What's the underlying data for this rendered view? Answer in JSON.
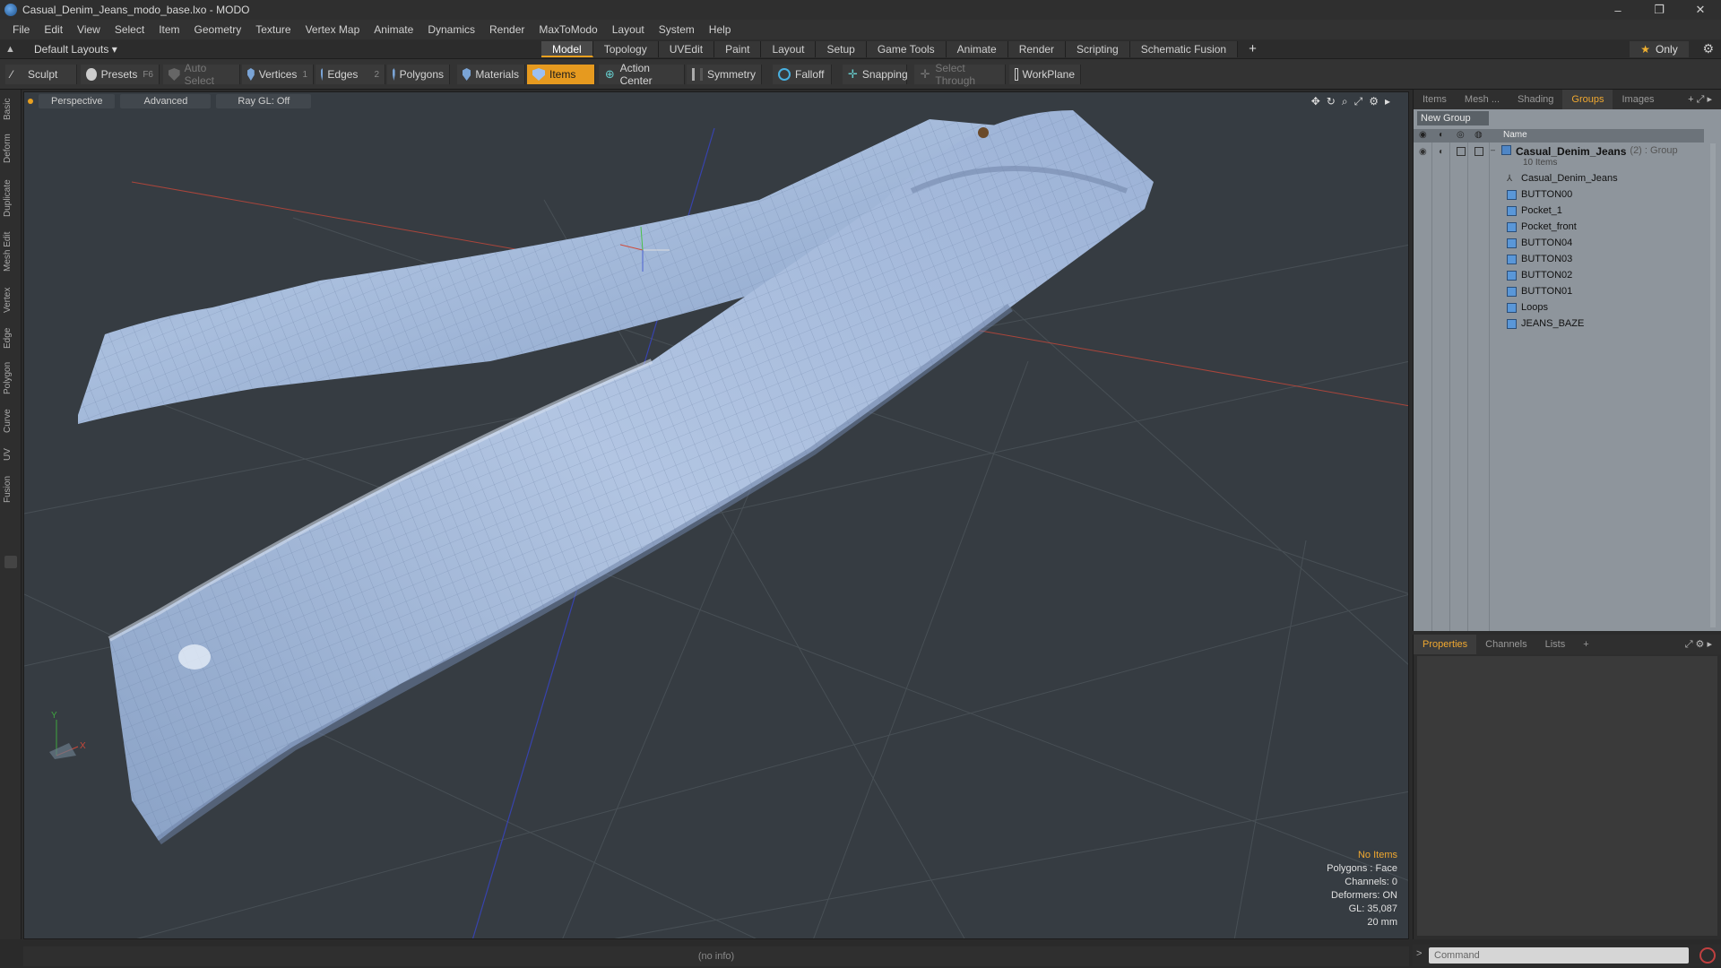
{
  "window": {
    "title": "Casual_Denim_Jeans_modo_base.lxo - MODO",
    "controls": [
      "–",
      "❐",
      "✕"
    ]
  },
  "menu": [
    "File",
    "Edit",
    "View",
    "Select",
    "Item",
    "Geometry",
    "Texture",
    "Vertex Map",
    "Animate",
    "Dynamics",
    "Render",
    "MaxToModo",
    "Layout",
    "System",
    "Help"
  ],
  "layoutbar": {
    "layout_name": "Default Layouts ▾",
    "tabs": [
      "Model",
      "Topology",
      "UVEdit",
      "Paint",
      "Layout",
      "Setup",
      "Game Tools",
      "Animate",
      "Render",
      "Scripting",
      "Schematic Fusion"
    ],
    "active_tab": "Model",
    "plus": "+",
    "only": "Only"
  },
  "toolbar": {
    "sculpt": "Sculpt",
    "presets": "Presets",
    "presets_key": "F6",
    "auto_select": "Auto Select",
    "vertices": "Vertices",
    "vertices_key": "1",
    "edges": "Edges",
    "edges_key": "2",
    "polygons": "Polygons",
    "materials": "Materials",
    "items": "Items",
    "action_center": "Action Center",
    "symmetry": "Symmetry",
    "falloff": "Falloff",
    "snapping": "Snapping",
    "select_through": "Select Through",
    "workplane": "WorkPlane"
  },
  "left_tabs": [
    "Basic",
    "Deform",
    "Duplicate",
    "Mesh Edit",
    "Vertex",
    "Edge",
    "Polygon",
    "Curve",
    "UV",
    "Fusion"
  ],
  "viewport": {
    "view": "Perspective",
    "shading": "Advanced",
    "raygl": "Ray GL: Off",
    "info": {
      "items": "No Items",
      "polygons": "Polygons : Face",
      "channels": "Channels: 0",
      "deformers": "Deformers: ON",
      "gl": "GL: 35,087",
      "unit": "20 mm"
    },
    "axis": {
      "y": "Y",
      "x": "X"
    },
    "colors": {
      "bg": "#363c42",
      "denim": "#9fb6d8",
      "x_axis": "#d04a3a",
      "z_axis": "#3a4ad0"
    }
  },
  "status": "(no info)",
  "items_panel": {
    "tabs": [
      "Items",
      "Mesh ...",
      "Shading",
      "Groups",
      "Images"
    ],
    "active_tab": "Groups",
    "new_group": "New Group",
    "name_header": "Name",
    "group": {
      "name": "Casual_Denim_Jeans",
      "suffix": "(2) : Group",
      "count": "10 Items"
    },
    "children": [
      "Casual_Denim_Jeans",
      "BUTTON00",
      "Pocket_1",
      "Pocket_front",
      "BUTTON04",
      "BUTTON03",
      "BUTTON02",
      "BUTTON01",
      "Loops",
      "JEANS_BAZE"
    ]
  },
  "properties_panel": {
    "tabs": [
      "Properties",
      "Channels",
      "Lists"
    ],
    "active_tab": "Properties",
    "plus": "+"
  },
  "command": {
    "placeholder": "Command",
    "arrow": ">"
  }
}
